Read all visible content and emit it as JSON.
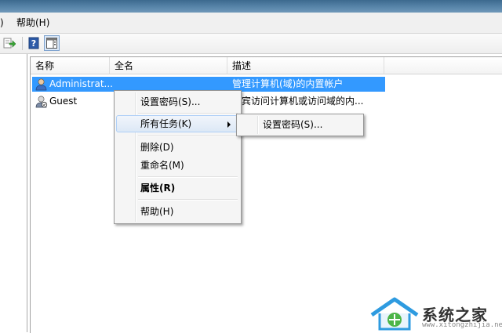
{
  "menubar": {
    "items": [
      ")",
      "帮助(H)"
    ]
  },
  "toolbar": {
    "icons": [
      "export-list-icon",
      "help-icon",
      "show-hide-action-pane-icon"
    ]
  },
  "list": {
    "columns": [
      "名称",
      "全名",
      "描述"
    ],
    "rows": [
      {
        "name": "Administrat...",
        "fullname": "",
        "description": "管理计算机(域)的内置帐户",
        "selected": true,
        "icon": "user-icon"
      },
      {
        "name": "Guest",
        "fullname": "",
        "description": "来宾访问计算机或访问域的内...",
        "selected": false,
        "icon": "guest-user-icon"
      }
    ]
  },
  "context_menu": {
    "items": [
      "设置密码(S)...",
      "所有任务(K)",
      "删除(D)",
      "重命名(M)",
      "属性(R)",
      "帮助(H)"
    ]
  },
  "submenu": {
    "items": [
      "设置密码(S)..."
    ]
  },
  "watermark": {
    "text": "系统之家",
    "url": "www.xitongzhijia.net"
  },
  "colors": {
    "selection": "#3399ff",
    "menu_hover_border": "#aecff7"
  }
}
